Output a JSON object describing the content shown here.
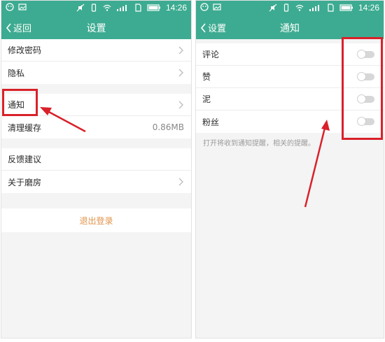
{
  "status": {
    "time": "14:26",
    "network": "4G"
  },
  "left": {
    "back_label": "返回",
    "title": "设置",
    "group1": [
      "修改密码",
      "隐私"
    ],
    "group2": [
      {
        "label": "通知",
        "value": ""
      },
      {
        "label": "清理缓存",
        "value": "0.86MB"
      }
    ],
    "group3": [
      "反馈建议",
      "关于磨房"
    ],
    "logout_label": "退出登录"
  },
  "right": {
    "back_label": "设置",
    "title": "通知",
    "items": [
      {
        "label": "评论",
        "enabled": false
      },
      {
        "label": "赞",
        "enabled": false
      },
      {
        "label": "泥",
        "enabled": false
      },
      {
        "label": "粉丝",
        "enabled": false
      }
    ],
    "hint": "打开将收到通知提醒，相关的提醒。"
  },
  "colors": {
    "header": "#3dab91",
    "highlight": "#d9212a",
    "logout": "#e2934b"
  }
}
